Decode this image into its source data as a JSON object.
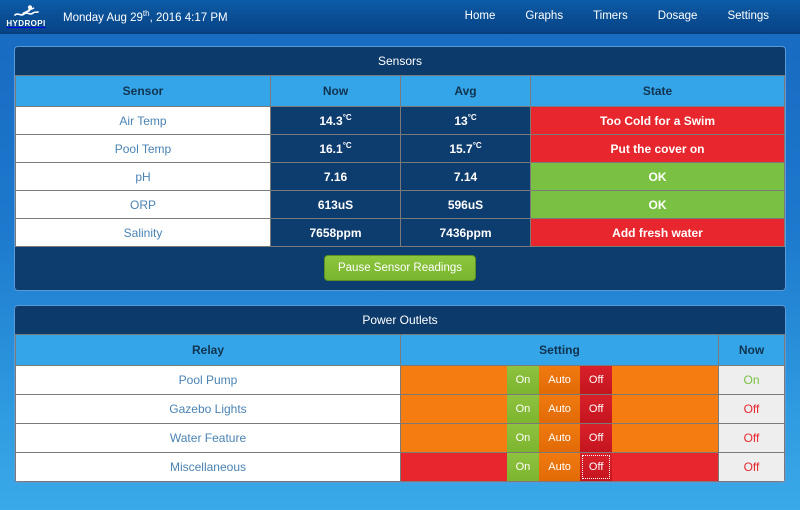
{
  "header": {
    "brand": "HYDROPI",
    "brand_icon": "swimmer-icon",
    "datetime_prefix": "Monday Aug 29",
    "datetime_ordinal": "th",
    "datetime_suffix": ", 2016 4:17 PM",
    "nav": [
      {
        "label": "Home"
      },
      {
        "label": "Graphs"
      },
      {
        "label": "Timers"
      },
      {
        "label": "Dosage"
      },
      {
        "label": "Settings"
      }
    ]
  },
  "sensors_panel": {
    "title": "Sensors",
    "columns": [
      "Sensor",
      "Now",
      "Avg",
      "State"
    ],
    "rows": [
      {
        "name": "Air Temp",
        "now_value": "14.3",
        "now_unit": "°C",
        "avg_value": "13",
        "avg_unit": "°C",
        "state": "Too Cold for a Swim",
        "state_kind": "bad"
      },
      {
        "name": "Pool Temp",
        "now_value": "16.1",
        "now_unit": "°C",
        "avg_value": "15.7",
        "avg_unit": "°C",
        "state": "Put the cover on",
        "state_kind": "bad"
      },
      {
        "name": "pH",
        "now_value": "7.16",
        "now_unit": "",
        "avg_value": "7.14",
        "avg_unit": "",
        "state": "OK",
        "state_kind": "good"
      },
      {
        "name": "ORP",
        "now_value": "613uS",
        "now_unit": "",
        "avg_value": "596uS",
        "avg_unit": "",
        "state": "OK",
        "state_kind": "good"
      },
      {
        "name": "Salinity",
        "now_value": "7658ppm",
        "now_unit": "",
        "avg_value": "7436ppm",
        "avg_unit": "",
        "state": "Add fresh water",
        "state_kind": "bad"
      }
    ],
    "pause_button": "Pause Sensor Readings"
  },
  "outlets_panel": {
    "title": "Power Outlets",
    "columns": [
      "Relay",
      "Setting",
      "Now"
    ],
    "segment_labels": {
      "on": "On",
      "auto": "Auto",
      "off": "Off"
    },
    "rows": [
      {
        "name": "Pool Pump",
        "setting": "Auto",
        "now": "On",
        "focused": false
      },
      {
        "name": "Gazebo Lights",
        "setting": "Auto",
        "now": "Off",
        "focused": false
      },
      {
        "name": "Water Feature",
        "setting": "Auto",
        "now": "Off",
        "focused": false
      },
      {
        "name": "Miscellaneous",
        "setting": "Off",
        "now": "Off",
        "focused": true
      }
    ]
  },
  "colors": {
    "brand_navy": "#0a4f95",
    "panel_navy": "#0c3a6b",
    "header_blue": "#34a5e8",
    "status_bad": "#e8262d",
    "status_good": "#7ac143",
    "setting_auto": "#f57c10",
    "setting_off": "#e8262d",
    "button_green": "#7ab52f"
  }
}
